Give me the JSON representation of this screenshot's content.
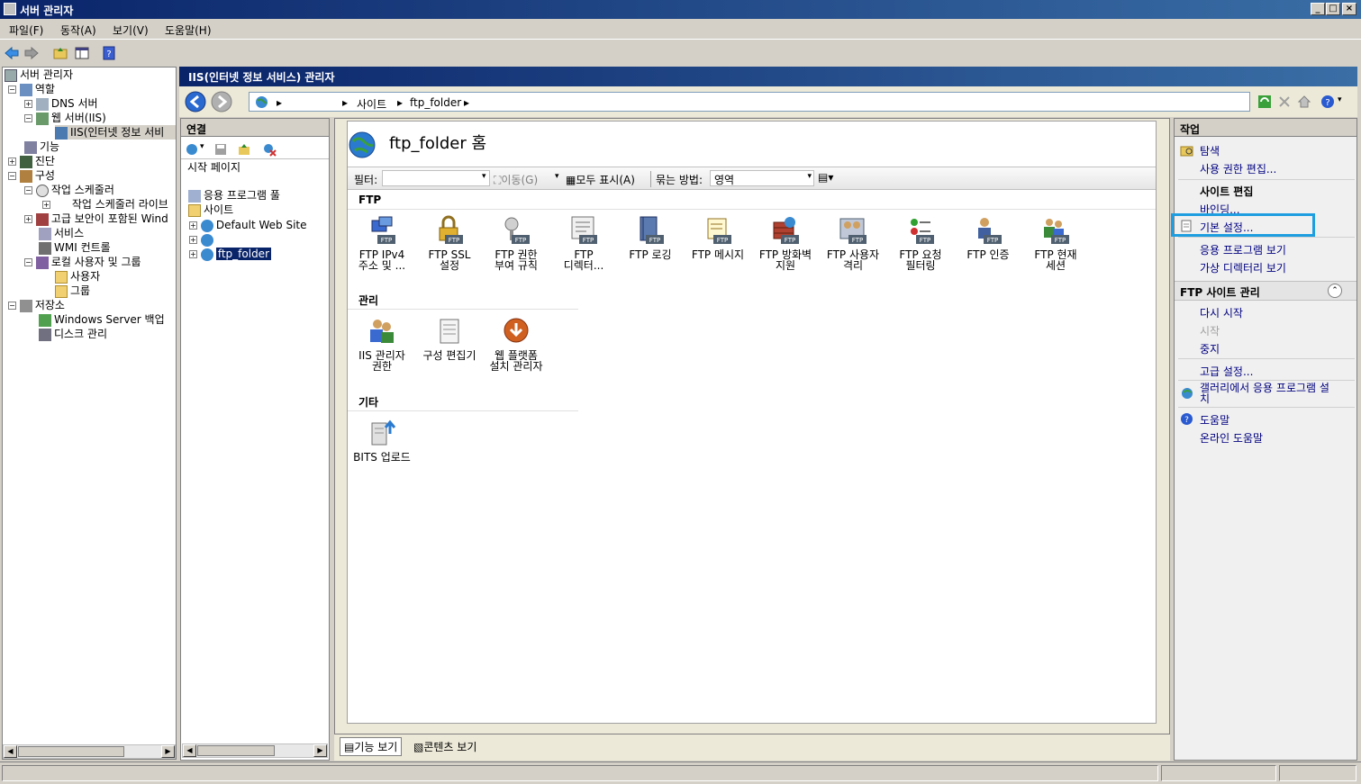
{
  "window": {
    "title": "서버 관리자"
  },
  "menu": [
    "파일(F)",
    "동작(A)",
    "보기(V)",
    "도움말(H)"
  ],
  "tree": {
    "root": "서버 관리자",
    "items": [
      {
        "label": "역할"
      },
      {
        "label": "DNS 서버"
      },
      {
        "label": "웹 서버(IIS)"
      },
      {
        "label": "IIS(인터넷 정보 서비"
      },
      {
        "label": "기능"
      },
      {
        "label": "진단"
      },
      {
        "label": "구성"
      },
      {
        "label": "작업 스케줄러"
      },
      {
        "label": "작업 스케줄러 라이브"
      },
      {
        "label": "고급 보안이 포함된 Wind"
      },
      {
        "label": "서비스"
      },
      {
        "label": "WMI 컨트롤"
      },
      {
        "label": "로컬 사용자 및 그룹"
      },
      {
        "label": "사용자"
      },
      {
        "label": "그룹"
      },
      {
        "label": "저장소"
      },
      {
        "label": "Windows Server 백업"
      },
      {
        "label": "디스크 관리"
      }
    ]
  },
  "iis": {
    "header": "IIS(인터넷 정보 서비스) 관리자",
    "breadcrumbs": [
      "사이트",
      "ftp_folder"
    ]
  },
  "connections": {
    "title": "연결",
    "items": [
      "시작 페이지",
      "응용 프로그램 풀",
      "사이트",
      "Default Web Site",
      "",
      "ftp_folder"
    ]
  },
  "center": {
    "title": "ftp_folder 홈",
    "filter_label": "필터:",
    "go_label": "이동(G)",
    "showall_label": "모두 표시(A)",
    "groupby_label": "묶는 방법:",
    "groupby_value": "영역",
    "sections": [
      {
        "name": "FTP",
        "features": [
          {
            "l1": "FTP IPv4",
            "l2": "주소 및 ..."
          },
          {
            "l1": "FTP SSL",
            "l2": "설정"
          },
          {
            "l1": "FTP 권한",
            "l2": "부여 규칙"
          },
          {
            "l1": "FTP",
            "l2": "디렉터..."
          },
          {
            "l1": "FTP 로깅",
            "l2": ""
          },
          {
            "l1": "FTP 메시지",
            "l2": ""
          },
          {
            "l1": "FTP 방화벽",
            "l2": "지원"
          },
          {
            "l1": "FTP 사용자",
            "l2": "격리"
          },
          {
            "l1": "FTP 요청",
            "l2": "필터링"
          },
          {
            "l1": "FTP 인증",
            "l2": ""
          },
          {
            "l1": "FTP 현재",
            "l2": "세션"
          }
        ]
      },
      {
        "name": "관리",
        "features": [
          {
            "l1": "IIS 관리자",
            "l2": "권한"
          },
          {
            "l1": "구성 편집기",
            "l2": ""
          },
          {
            "l1": "웹 플랫폼",
            "l2": "설치 관리자"
          }
        ]
      },
      {
        "name": "기타",
        "features": [
          {
            "l1": "BITS 업로드",
            "l2": ""
          }
        ]
      }
    ]
  },
  "viewtabs": {
    "features": "기능 보기",
    "content": "콘텐츠 보기"
  },
  "actions": {
    "title": "작업",
    "explore": "탐색",
    "edit_perms": "사용 권한 편집...",
    "site_edit_head": "사이트 편집",
    "bindings": "바인딩...",
    "basic_settings": "기본 설정...",
    "view_apps": "응용 프로그램 보기",
    "view_vdirs": "가상 디렉터리 보기",
    "ftp_manage_head": "FTP 사이트 관리",
    "restart": "다시 시작",
    "start": "시작",
    "stop": "중지",
    "advanced": "고급 설정...",
    "gallery_l1": "갤러리에서 응용 프로그램 설",
    "gallery_l2": "치",
    "help": "도움말",
    "online_help": "온라인 도움말"
  },
  "colors": {
    "highlight": "#1e9ee0",
    "title_dark": "#0a246a",
    "link": "#000080"
  }
}
